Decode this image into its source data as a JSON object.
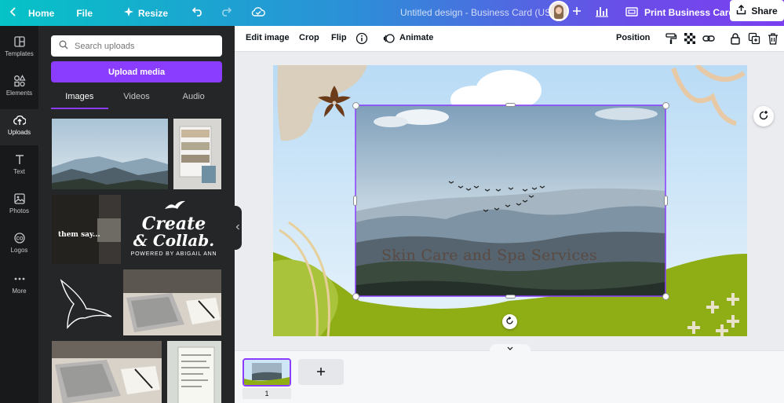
{
  "topbar": {
    "home_label": "Home",
    "file_label": "File",
    "resize_label": "Resize",
    "design_title": "Untitled design - Business Card (US)",
    "print_label": "Print Business Cards",
    "share_label": "Share"
  },
  "rail": {
    "items": [
      {
        "label": "Templates",
        "icon": "templates-icon"
      },
      {
        "label": "Elements",
        "icon": "elements-icon"
      },
      {
        "label": "Uploads",
        "icon": "upload-cloud-icon"
      },
      {
        "label": "Text",
        "icon": "text-icon"
      },
      {
        "label": "Photos",
        "icon": "photos-icon"
      },
      {
        "label": "Logos",
        "icon": "logos-icon"
      },
      {
        "label": "More",
        "icon": "more-icon"
      }
    ]
  },
  "panel": {
    "search_placeholder": "Search uploads",
    "upload_button": "Upload media",
    "tabs": [
      "Images",
      "Videos",
      "Audio"
    ],
    "active_tab": "Images",
    "logo_thumb": {
      "line1": "Create",
      "line2": "& Collab.",
      "line3": "POWERED BY ABIGAIL ANN"
    },
    "quote_thumb": {
      "line1": "them say..."
    }
  },
  "context_toolbar": {
    "edit_image": "Edit image",
    "crop": "Crop",
    "flip": "Flip",
    "animate": "Animate",
    "position": "Position"
  },
  "canvas": {
    "headline": "Skin Care and Spa Services",
    "accent_green": "#8fae16",
    "sky_color": "#cfe6f7",
    "selection_color": "#8b3dff"
  },
  "pages": {
    "current_page": "1"
  }
}
